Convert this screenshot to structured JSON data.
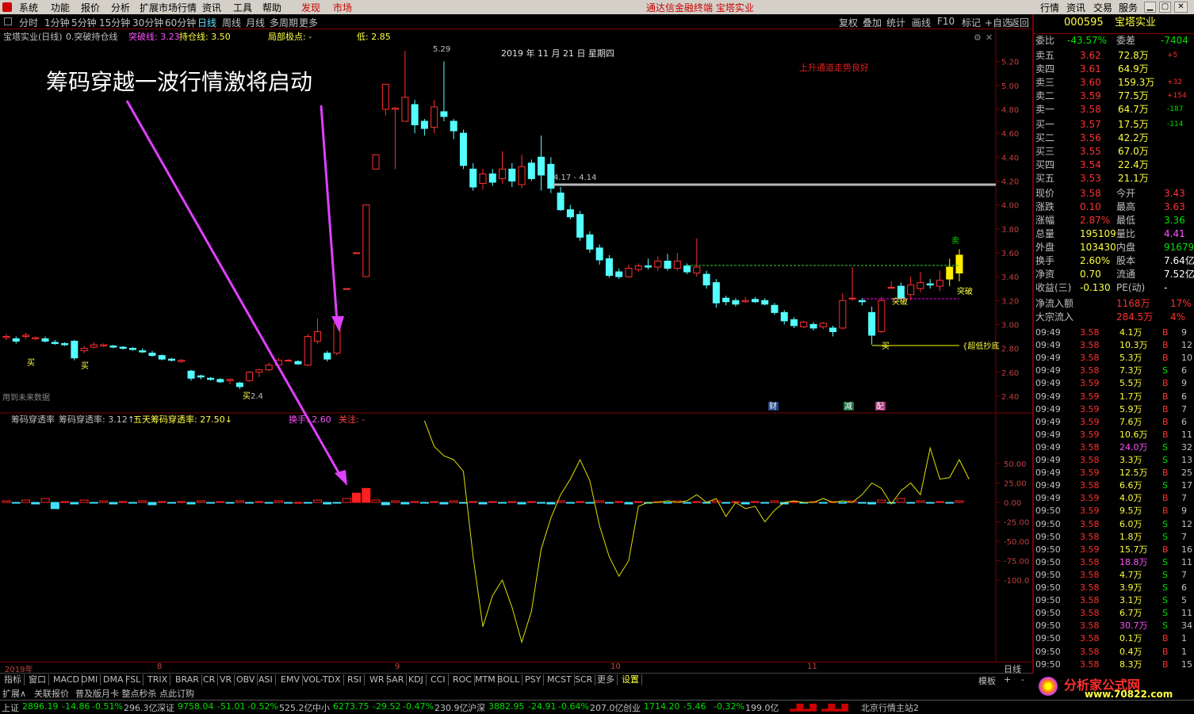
{
  "menu": [
    "系统",
    "功能",
    "报价",
    "分析",
    "扩展市场行情",
    "资讯",
    "工具",
    "帮助",
    "发现",
    "市场"
  ],
  "app_title": "通达信金融终端 宝塔实业",
  "right_menu": [
    "行情",
    "资讯",
    "交易",
    "服务"
  ],
  "periods": [
    "分时",
    "1分钟",
    "5分钟",
    "15分钟",
    "30分钟",
    "60分钟",
    "日线",
    "周线",
    "月线",
    "多周期",
    "更多"
  ],
  "active_period": "日线",
  "chart_tools": [
    "复权",
    "叠加",
    "统计",
    "画线",
    "F10",
    "标记",
    "+自选",
    "返回"
  ],
  "main_header": {
    "name": "宝塔实业(日线)",
    "indicator": "0.突破持仓线",
    "k1": "突破线: 3.23",
    "k2": "持仓线: 3.50",
    "k3": "局部极点: -",
    "k4": "低: 2.85"
  },
  "annotation": "筹码穿越一波行情激将启动",
  "date_label": "2019 年 11 月 21 日 星期四",
  "trend_note": "上升通道走势良好",
  "peak": "5.29",
  "level_label": "4.17 - 4.14",
  "future_note": "用到未来数据",
  "chart_marks": {
    "buy": "买",
    "sell": "卖",
    "break": "突破",
    "low": "{超低抄底",
    "cai": "财",
    "jian": "减",
    "pei": "配",
    "low4": "2.4"
  },
  "price_ticks": [
    "5.20",
    "5.00",
    "4.80",
    "4.60",
    "4.40",
    "4.20",
    "4.00",
    "3.80",
    "3.60",
    "3.40",
    "3.20",
    "3.00",
    "2.80",
    "2.60",
    "2.40"
  ],
  "ind_header": {
    "name": "筹码穿透率",
    "v1": "筹码穿透率: 3.12↑",
    "v2": "五天筹码穿透率: 27.50↓",
    "v3": "换手: 2.60",
    "v4": "关注: -"
  },
  "ind_ticks": [
    "50.00",
    "25.00",
    "0.00",
    "-25.00",
    "-50.00",
    "-75.00",
    "-100.0"
  ],
  "x_labels": [
    "2019年",
    "8",
    "9",
    "10",
    "11"
  ],
  "x_mode": "日线",
  "ind_tabs": [
    "指标",
    "窗口",
    "MACD",
    "DMI",
    "DMA",
    "FSL",
    "TRIX",
    "BRAR",
    "CR",
    "VR",
    "OBV",
    "ASI",
    "EMV",
    "VOL-TDX",
    "RSI",
    "WR",
    "SAR",
    "KDJ",
    "CCI",
    "ROC",
    "MTM",
    "BOLL",
    "PSY",
    "MCST",
    "SCR",
    "更多",
    "设置"
  ],
  "ind_right": [
    "模板",
    "+",
    "-"
  ],
  "ext": [
    "扩展∧",
    "关联报价",
    "普及版月卡 整点秒杀 点此订购"
  ],
  "status": [
    {
      "name": "上证",
      "v": "2896.19",
      "c": "-14.86",
      "p": "-0.51%",
      "a": "296.3亿"
    },
    {
      "name": "深证",
      "v": "9758.04",
      "c": "-51.01",
      "p": "-0.52%",
      "a": "525.2亿"
    },
    {
      "name": "中小",
      "v": "6273.75",
      "c": "-29.52",
      "p": "-0.47%",
      "a": "230.9亿"
    },
    {
      "name": "沪深",
      "v": "3882.95",
      "c": "-24.91",
      "p": "-0.64%",
      "a": "207.0亿"
    },
    {
      "name": "创业",
      "v": "1714.20",
      "c": "-5.46",
      "p": "-0.32%",
      "a": "199.0亿"
    }
  ],
  "server": "北京行情主站2",
  "stock": {
    "code": "000595",
    "name": "宝塔实业"
  },
  "weibi": {
    "l1": "委比",
    "v1": "-43.57%",
    "l2": "委差",
    "v2": "-7404"
  },
  "asks": [
    {
      "l": "卖五",
      "p": "3.62",
      "v": "72.8万",
      "d": "+5"
    },
    {
      "l": "卖四",
      "p": "3.61",
      "v": "64.9万",
      "d": ""
    },
    {
      "l": "卖三",
      "p": "3.60",
      "v": "159.3万",
      "d": "+32"
    },
    {
      "l": "卖二",
      "p": "3.59",
      "v": "77.5万",
      "d": "+154"
    },
    {
      "l": "卖一",
      "p": "3.58",
      "v": "64.7万",
      "d": "-187"
    }
  ],
  "bids": [
    {
      "l": "买一",
      "p": "3.57",
      "v": "17.5万",
      "d": "-114"
    },
    {
      "l": "买二",
      "p": "3.56",
      "v": "42.2万",
      "d": ""
    },
    {
      "l": "买三",
      "p": "3.55",
      "v": "67.0万",
      "d": ""
    },
    {
      "l": "买四",
      "p": "3.54",
      "v": "22.4万",
      "d": ""
    },
    {
      "l": "买五",
      "p": "3.53",
      "v": "21.1万",
      "d": ""
    }
  ],
  "quote": [
    {
      "l1": "现价",
      "v1": "3.58",
      "l2": "今开",
      "v2": "3.43"
    },
    {
      "l1": "涨跌",
      "v1": "0.10",
      "l2": "最高",
      "v2": "3.63"
    },
    {
      "l1": "涨幅",
      "v1": "2.87%",
      "l2": "最低",
      "v2": "3.36"
    },
    {
      "l1": "总量",
      "v1": "195109",
      "l2": "量比",
      "v2": "4.41"
    },
    {
      "l1": "外盘",
      "v1": "103430",
      "l2": "内盘",
      "v2": "91679"
    },
    {
      "l1": "换手",
      "v1": "2.60%",
      "l2": "股本",
      "v2": "7.64亿"
    },
    {
      "l1": "净资",
      "v1": "0.70",
      "l2": "流通",
      "v2": "7.52亿"
    },
    {
      "l1": "收益(三)",
      "v1": "-0.130",
      "l2": "PE(动)",
      "v2": "-"
    }
  ],
  "flow": [
    {
      "l": "净流入额",
      "v": "1168万",
      "p": "17%"
    },
    {
      "l": "大宗流入",
      "v": "284.5万",
      "p": "4%"
    }
  ],
  "ticks": [
    {
      "t": "09:49",
      "p": "3.58",
      "v": "4.1万",
      "s": "B",
      "n": "9"
    },
    {
      "t": "09:49",
      "p": "3.58",
      "v": "10.3万",
      "s": "B",
      "n": "12"
    },
    {
      "t": "09:49",
      "p": "3.58",
      "v": "5.3万",
      "s": "B",
      "n": "10"
    },
    {
      "t": "09:49",
      "p": "3.58",
      "v": "7.3万",
      "s": "S",
      "n": "6"
    },
    {
      "t": "09:49",
      "p": "3.59",
      "v": "5.5万",
      "s": "B",
      "n": "9"
    },
    {
      "t": "09:49",
      "p": "3.59",
      "v": "1.7万",
      "s": "B",
      "n": "6"
    },
    {
      "t": "09:49",
      "p": "3.59",
      "v": "5.9万",
      "s": "B",
      "n": "7"
    },
    {
      "t": "09:49",
      "p": "3.59",
      "v": "7.6万",
      "s": "B",
      "n": "6"
    },
    {
      "t": "09:49",
      "p": "3.59",
      "v": "10.6万",
      "s": "B",
      "n": "11"
    },
    {
      "t": "09:49",
      "p": "3.58",
      "v": "24.0万",
      "s": "S",
      "n": "32"
    },
    {
      "t": "09:49",
      "p": "3.58",
      "v": "3.3万",
      "s": "S",
      "n": "13"
    },
    {
      "t": "09:49",
      "p": "3.59",
      "v": "12.5万",
      "s": "B",
      "n": "25"
    },
    {
      "t": "09:49",
      "p": "3.58",
      "v": "6.6万",
      "s": "S",
      "n": "17"
    },
    {
      "t": "09:49",
      "p": "3.59",
      "v": "4.0万",
      "s": "B",
      "n": "7"
    },
    {
      "t": "09:50",
      "p": "3.59",
      "v": "9.5万",
      "s": "B",
      "n": "9"
    },
    {
      "t": "09:50",
      "p": "3.58",
      "v": "6.0万",
      "s": "S",
      "n": "12"
    },
    {
      "t": "09:50",
      "p": "3.58",
      "v": "1.8万",
      "s": "S",
      "n": "7"
    },
    {
      "t": "09:50",
      "p": "3.59",
      "v": "15.7万",
      "s": "B",
      "n": "16"
    },
    {
      "t": "09:50",
      "p": "3.58",
      "v": "18.8万",
      "s": "S",
      "n": "11"
    },
    {
      "t": "09:50",
      "p": "3.58",
      "v": "4.7万",
      "s": "S",
      "n": "7"
    },
    {
      "t": "09:50",
      "p": "3.58",
      "v": "3.9万",
      "s": "S",
      "n": "6"
    },
    {
      "t": "09:50",
      "p": "3.58",
      "v": "3.1万",
      "s": "S",
      "n": "5"
    },
    {
      "t": "09:50",
      "p": "3.58",
      "v": "6.7万",
      "s": "S",
      "n": "11"
    },
    {
      "t": "09:50",
      "p": "3.58",
      "v": "30.7万",
      "s": "S",
      "n": "34"
    },
    {
      "t": "09:50",
      "p": "3.58",
      "v": "0.1万",
      "s": "B",
      "n": "1"
    },
    {
      "t": "09:50",
      "p": "3.58",
      "v": "0.4万",
      "s": "B",
      "n": "1"
    },
    {
      "t": "09:50",
      "p": "3.58",
      "v": "8.3万",
      "s": "B",
      "n": "15"
    }
  ],
  "logo": {
    "t1": "分析家公式网",
    "t2": "www.70822.com"
  },
  "chart_data": {
    "type": "candlestick",
    "ylim": [
      2.3,
      5.35
    ],
    "candles": [
      [
        2.89,
        2.9,
        2.92,
        2.87
      ],
      [
        2.88,
        2.86,
        2.9,
        2.84
      ],
      [
        2.9,
        2.91,
        2.93,
        2.88
      ],
      [
        2.88,
        2.89,
        2.9,
        2.87
      ],
      [
        2.88,
        2.86,
        2.9,
        2.85
      ],
      [
        2.85,
        2.84,
        2.87,
        2.83
      ],
      [
        2.84,
        2.83,
        2.85,
        2.82
      ],
      [
        2.86,
        2.72,
        2.87,
        2.7
      ],
      [
        2.78,
        2.8,
        2.82,
        2.76
      ],
      [
        2.81,
        2.83,
        2.85,
        2.8
      ],
      [
        2.82,
        2.83,
        2.84,
        2.81
      ],
      [
        2.82,
        2.81,
        2.83,
        2.8
      ],
      [
        2.81,
        2.8,
        2.82,
        2.79
      ],
      [
        2.8,
        2.79,
        2.81,
        2.78
      ],
      [
        2.78,
        2.77,
        2.8,
        2.76
      ],
      [
        2.76,
        2.74,
        2.78,
        2.73
      ],
      [
        2.74,
        2.71,
        2.75,
        2.7
      ],
      [
        2.71,
        2.7,
        2.72,
        2.69
      ],
      [
        2.69,
        2.7,
        2.71,
        2.68
      ],
      [
        2.61,
        2.55,
        2.62,
        2.53
      ],
      [
        2.57,
        2.56,
        2.58,
        2.54
      ],
      [
        2.55,
        2.54,
        2.56,
        2.53
      ],
      [
        2.54,
        2.52,
        2.55,
        2.51
      ],
      [
        2.53,
        2.54,
        2.55,
        2.5
      ],
      [
        2.51,
        2.48,
        2.52,
        2.46
      ],
      [
        2.53,
        2.6,
        2.61,
        2.52
      ],
      [
        2.6,
        2.62,
        2.63,
        2.56
      ],
      [
        2.62,
        2.66,
        2.68,
        2.61
      ],
      [
        2.66,
        2.7,
        2.72,
        2.65
      ],
      [
        2.7,
        2.7,
        2.71,
        2.69
      ],
      [
        2.69,
        2.67,
        2.7,
        2.66
      ],
      [
        2.66,
        2.9,
        2.92,
        2.65
      ],
      [
        2.86,
        2.94,
        3.05,
        2.84
      ],
      [
        2.76,
        2.71,
        2.78,
        2.69
      ],
      [
        2.76,
        3.01,
        3.02,
        2.74
      ],
      [
        3.3,
        3.3,
        3.3,
        3.3
      ],
      [
        3.6,
        3.6,
        3.6,
        3.6
      ],
      [
        3.4,
        4.0,
        4.0,
        3.4
      ],
      [
        4.3,
        4.42,
        4.42,
        4.3
      ],
      [
        4.8,
        5.01,
        5.01,
        4.75
      ],
      [
        4.8,
        4.81,
        4.82,
        4.3
      ],
      [
        4.7,
        4.9,
        5.29,
        4.7
      ],
      [
        4.84,
        4.67,
        4.88,
        4.6
      ],
      [
        4.7,
        4.64,
        4.72,
        4.58
      ],
      [
        4.65,
        4.82,
        4.88,
        4.6
      ],
      [
        4.78,
        4.74,
        5.2,
        4.7
      ],
      [
        4.7,
        4.62,
        4.72,
        4.55
      ],
      [
        4.6,
        4.33,
        4.63,
        4.3
      ],
      [
        4.3,
        4.15,
        4.35,
        4.12
      ],
      [
        4.18,
        4.26,
        4.3,
        4.13
      ],
      [
        4.26,
        4.19,
        4.3,
        4.16
      ],
      [
        4.22,
        4.3,
        4.45,
        4.18
      ],
      [
        4.3,
        4.2,
        4.35,
        4.15
      ],
      [
        4.17,
        4.32,
        4.42,
        4.14
      ],
      [
        4.35,
        4.22,
        4.38,
        4.2
      ],
      [
        4.4,
        4.25,
        4.58,
        4.12
      ],
      [
        4.34,
        4.14,
        4.4,
        4.1
      ],
      [
        4.1,
        3.96,
        4.15,
        3.95
      ],
      [
        3.96,
        3.9,
        4.0,
        3.88
      ],
      [
        3.92,
        3.73,
        3.95,
        3.7
      ],
      [
        3.75,
        3.63,
        3.78,
        3.6
      ],
      [
        3.64,
        3.54,
        3.67,
        3.5
      ],
      [
        3.55,
        3.41,
        3.58,
        3.39
      ],
      [
        3.44,
        3.4,
        3.47,
        3.38
      ],
      [
        3.4,
        3.47,
        3.5,
        3.39
      ],
      [
        3.46,
        3.49,
        3.51,
        3.44
      ],
      [
        3.49,
        3.48,
        3.55,
        3.46
      ],
      [
        3.48,
        3.53,
        3.57,
        3.45
      ],
      [
        3.53,
        3.47,
        3.59,
        3.45
      ],
      [
        3.47,
        3.53,
        3.6,
        3.45
      ],
      [
        3.49,
        3.44,
        3.51,
        3.42
      ],
      [
        3.43,
        3.48,
        3.72,
        3.4
      ],
      [
        3.42,
        3.33,
        3.45,
        3.3
      ],
      [
        3.35,
        3.18,
        3.38,
        3.14
      ],
      [
        3.22,
        3.19,
        3.24,
        3.16
      ],
      [
        3.2,
        3.17,
        3.22,
        3.15
      ],
      [
        3.19,
        3.2,
        3.23,
        3.18
      ],
      [
        3.21,
        3.19,
        3.23,
        3.18
      ],
      [
        3.2,
        3.17,
        3.22,
        3.16
      ],
      [
        3.16,
        3.1,
        3.18,
        3.08
      ],
      [
        3.1,
        3.03,
        3.12,
        3.0
      ],
      [
        3.04,
        2.99,
        3.06,
        2.97
      ],
      [
        2.98,
        3.02,
        3.03,
        2.97
      ],
      [
        3.0,
        2.97,
        3.02,
        2.95
      ],
      [
        2.98,
        3.01,
        3.02,
        2.96
      ],
      [
        2.97,
        2.94,
        2.99,
        2.9
      ],
      [
        2.97,
        3.2,
        3.26,
        2.96
      ],
      [
        3.22,
        3.22,
        3.48,
        3.2
      ],
      [
        3.2,
        3.19,
        3.22,
        3.16
      ],
      [
        3.1,
        2.91,
        3.15,
        2.83
      ],
      [
        2.94,
        3.2,
        3.23,
        2.93
      ],
      [
        3.31,
        3.31,
        3.36,
        3.3
      ],
      [
        3.32,
        3.22,
        3.35,
        3.2
      ],
      [
        3.25,
        3.33,
        3.4,
        3.2
      ],
      [
        3.3,
        3.35,
        3.44,
        3.27
      ],
      [
        3.34,
        3.33,
        3.38,
        3.3
      ],
      [
        3.32,
        3.37,
        3.45,
        3.28
      ],
      [
        3.38,
        3.48,
        3.55,
        3.32
      ],
      [
        3.43,
        3.58,
        3.63,
        3.36
      ]
    ],
    "indicator_bars": [
      2,
      -1,
      3,
      -2,
      5,
      -8,
      1,
      -2,
      3,
      -1,
      2,
      -2,
      1,
      -1,
      2,
      -3,
      1,
      -1,
      1,
      -2,
      2,
      -1,
      1,
      -1,
      2,
      -1,
      1,
      -1,
      2,
      -1,
      0,
      -1,
      3,
      -2,
      -1,
      5,
      12,
      18,
      3,
      -3,
      2,
      -2,
      1,
      -1,
      1,
      -2,
      2,
      -1,
      1,
      -2,
      1,
      -1,
      1,
      -2,
      1,
      -1,
      -2,
      2,
      -1,
      1,
      -1,
      2,
      -1,
      1,
      -2,
      1,
      -1,
      1,
      -1,
      2,
      -1,
      1,
      -1,
      2,
      -1,
      1,
      -2,
      1,
      -1,
      2,
      -2,
      1,
      -1,
      1,
      -1,
      1,
      -1,
      2,
      -1,
      -2,
      3,
      -1,
      5,
      -1,
      2,
      -1,
      1,
      -1,
      2
    ],
    "indicator_line": [
      [
        43,
        105
      ],
      [
        44,
        72
      ],
      [
        45,
        60
      ],
      [
        46,
        55
      ],
      [
        47,
        40
      ],
      [
        48,
        -70
      ],
      [
        49,
        -160
      ],
      [
        50,
        -120
      ],
      [
        51,
        -100
      ],
      [
        52,
        -135
      ],
      [
        53,
        -180
      ],
      [
        54,
        -140
      ],
      [
        55,
        -60
      ],
      [
        56,
        -20
      ],
      [
        57,
        10
      ],
      [
        58,
        30
      ],
      [
        59,
        55
      ],
      [
        60,
        28
      ],
      [
        61,
        -30
      ],
      [
        62,
        -70
      ],
      [
        63,
        -95
      ],
      [
        64,
        -75
      ],
      [
        65,
        -5
      ],
      [
        66,
        0
      ],
      [
        67,
        0
      ],
      [
        68,
        2
      ],
      [
        69,
        0
      ],
      [
        70,
        2
      ],
      [
        71,
        10
      ],
      [
        72,
        0
      ],
      [
        73,
        5
      ],
      [
        74,
        -18
      ],
      [
        75,
        0
      ],
      [
        76,
        -8
      ],
      [
        77,
        -5
      ],
      [
        78,
        -25
      ],
      [
        79,
        -10
      ],
      [
        80,
        0
      ],
      [
        81,
        2
      ],
      [
        82,
        0
      ],
      [
        83,
        0
      ],
      [
        84,
        5
      ],
      [
        85,
        0
      ],
      [
        86,
        2
      ],
      [
        87,
        0
      ],
      [
        88,
        10
      ],
      [
        89,
        25
      ],
      [
        90,
        18
      ],
      [
        91,
        -2
      ],
      [
        92,
        15
      ],
      [
        93,
        25
      ],
      [
        94,
        10
      ],
      [
        95,
        70
      ],
      [
        96,
        30
      ],
      [
        97,
        32
      ],
      [
        98,
        55
      ],
      [
        99,
        30
      ]
    ]
  }
}
